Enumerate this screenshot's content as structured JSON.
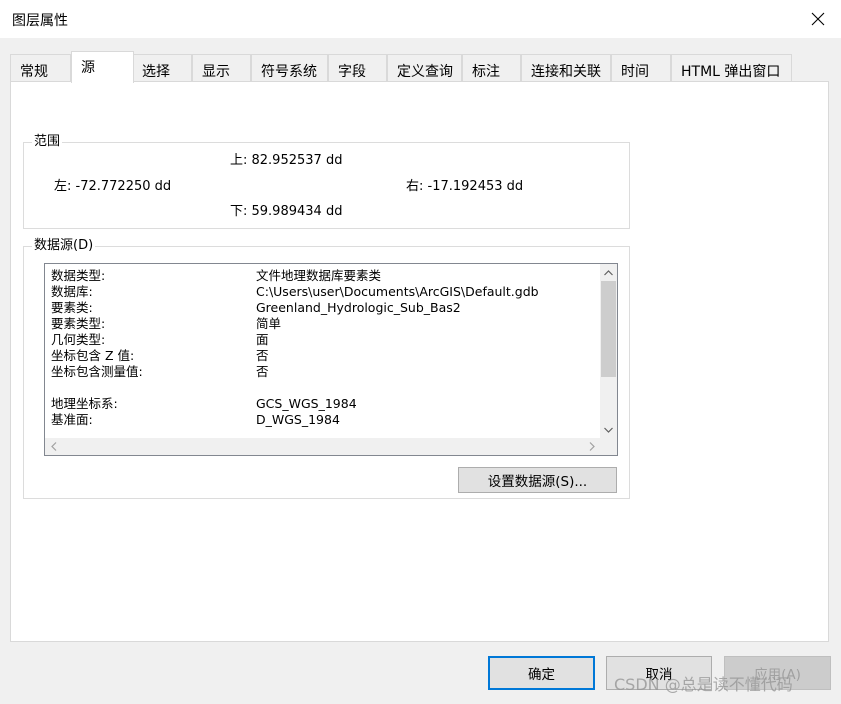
{
  "window": {
    "title": "图层属性"
  },
  "tabs": [
    {
      "label": "常规"
    },
    {
      "label": "源"
    },
    {
      "label": "选择"
    },
    {
      "label": "显示"
    },
    {
      "label": "符号系统"
    },
    {
      "label": "字段"
    },
    {
      "label": "定义查询"
    },
    {
      "label": "标注"
    },
    {
      "label": "连接和关联"
    },
    {
      "label": "时间"
    },
    {
      "label": "HTML 弹出窗口"
    }
  ],
  "active_tab": "源",
  "extent": {
    "group_title": "范围",
    "top": "上:  82.952537 dd",
    "left": "左: -72.772250 dd",
    "right": "右:  -17.192453 dd",
    "bottom": "下:  59.989434 dd"
  },
  "datasource": {
    "group_title": "数据源(D)",
    "rows": [
      {
        "key": "数据类型:",
        "value": "文件地理数据库要素类"
      },
      {
        "key": "数据库:",
        "value": "C:\\Users\\user\\Documents\\ArcGIS\\Default.gdb"
      },
      {
        "key": "要素类:",
        "value": "Greenland_Hydrologic_Sub_Bas2"
      },
      {
        "key": "要素类型:",
        "value": "简单"
      },
      {
        "key": "几何类型:",
        "value": "面"
      },
      {
        "key": "坐标包含 Z 值:",
        "value": "否"
      },
      {
        "key": "坐标包含测量值:",
        "value": "否"
      },
      {
        "key": "",
        "value": ""
      },
      {
        "key": "地理坐标系:",
        "value": "GCS_WGS_1984"
      },
      {
        "key": "基准面:",
        "value": "D_WGS_1984"
      }
    ],
    "set_source_button": "设置数据源(S)..."
  },
  "buttons": {
    "ok": "确定",
    "cancel": "取消",
    "apply": "应用(A)"
  },
  "watermark": "CSDN @总是读不懂代码",
  "colors": {
    "accent": "#0078d7",
    "panel_bg": "#ffffff",
    "window_bg": "#f0f0f0"
  }
}
